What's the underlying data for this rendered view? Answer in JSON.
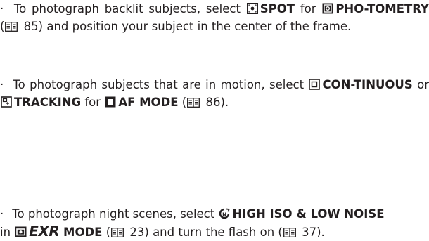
{
  "items": [
    {
      "parts": [
        {
          "type": "text",
          "text": "To photograph backlit subjects, select "
        },
        {
          "type": "icon",
          "icon": "spot-metering-icon"
        },
        {
          "type": "bold",
          "text": "SPOT"
        },
        {
          "type": "text",
          "text": " for "
        },
        {
          "type": "icon",
          "icon": "photometry-icon"
        },
        {
          "type": "bold",
          "text": "PHO-TOMETRY"
        },
        {
          "type": "text",
          "text": " ("
        },
        {
          "type": "icon",
          "icon": "page-reference-icon"
        },
        {
          "type": "text",
          "text": " 85) and position your subject in the center of the frame."
        }
      ]
    },
    {
      "parts": [
        {
          "type": "text",
          "text": "To photograph subjects that are in motion, select "
        },
        {
          "type": "icon",
          "icon": "continuous-af-icon"
        },
        {
          "type": "bold",
          "text": "CON-TINUOUS"
        },
        {
          "type": "text",
          "text": " or "
        },
        {
          "type": "icon",
          "icon": "tracking-af-icon"
        },
        {
          "type": "bold",
          "text": "TRACKING"
        },
        {
          "type": "text",
          "text": " for "
        },
        {
          "type": "icon",
          "icon": "af-mode-icon"
        },
        {
          "type": "bold",
          "text": "AF MODE"
        },
        {
          "type": "text",
          "text": " ("
        },
        {
          "type": "icon",
          "icon": "page-reference-icon"
        },
        {
          "type": "text",
          "text": " 86)."
        }
      ]
    },
    {
      "parts": [
        {
          "type": "text",
          "text": "To photograph night scenes, select "
        },
        {
          "type": "icon",
          "icon": "high-iso-low-noise-icon"
        },
        {
          "type": "bold",
          "text": "HIGH ISO & LOW NOISE"
        },
        {
          "type": "text",
          "text": " in "
        },
        {
          "type": "icon",
          "icon": "camera-mode-icon"
        },
        {
          "type": "exr",
          "text": "EXR"
        },
        {
          "type": "bold",
          "text": " MODE"
        },
        {
          "type": "text",
          "text": " ("
        },
        {
          "type": "icon",
          "icon": "page-reference-icon"
        },
        {
          "type": "text",
          "text": " 23) and turn the flash on ("
        },
        {
          "type": "icon",
          "icon": "page-reference-icon"
        },
        {
          "type": "text",
          "text": " 37)."
        }
      ]
    }
  ]
}
